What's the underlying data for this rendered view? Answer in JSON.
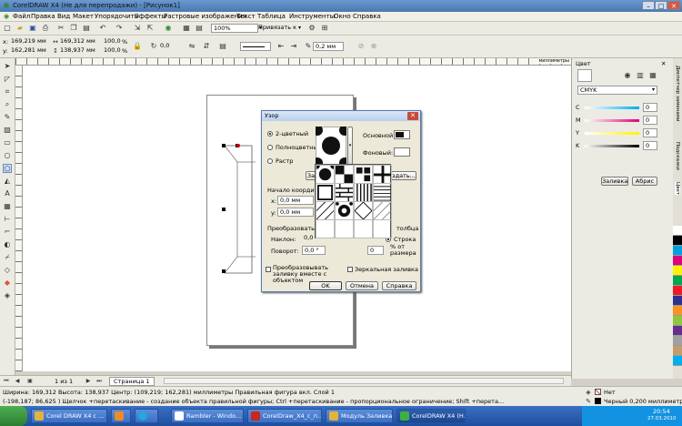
{
  "window": {
    "title": "CorelDRAW X4 (Не для перепродажи) - [Рисунок1]"
  },
  "menu": [
    "Файл",
    "Правка",
    "Вид",
    "Макет",
    "Упорядочить",
    "Эффекты",
    "Растровые изображения",
    "Текст",
    "Таблица",
    "Инструменты",
    "Окно",
    "Справка"
  ],
  "toolbar": {
    "zoom": "100%",
    "snap": "Привязать к"
  },
  "propbar": {
    "x": "169,219 мм",
    "y": "162,281 мм",
    "w": "169,312 мм",
    "h": "138,937 мм",
    "sx": "100,0",
    "sy": "100,0",
    "pct": "%",
    "angle": "0,0",
    "outline": "0,2 мм"
  },
  "ruler": {
    "unit": "миллиметры"
  },
  "docker": {
    "title": "Цвет",
    "model": "CMYK",
    "channels": [
      {
        "label": "C",
        "value": "0"
      },
      {
        "label": "M",
        "value": "0"
      },
      {
        "label": "Y",
        "value": "0"
      },
      {
        "label": "K",
        "value": "0"
      }
    ],
    "fill_btn": "Заливка",
    "outline_btn": "Абрис",
    "tabs": [
      "Диспетчер заменами",
      "Подсказки",
      "Цвет"
    ]
  },
  "dialog": {
    "title": "Узор",
    "close": "✕",
    "radio_2color": "2-цветный",
    "radio_full": "Полноцветный",
    "radio_bitmap": "Растр",
    "front_label": "Основной:",
    "back_label": "Фоновый:",
    "load_partial": "За",
    "edit_partial": "здать...",
    "origin": "Начало координат",
    "x_label": "x:",
    "x_val": "0,0 мм",
    "y_label": "y:",
    "y_val": "0,0 мм",
    "transform": "Преобразовать",
    "skew_label": "Наклон:",
    "skew_val": "0,0",
    "rotate_label": "Поворот:",
    "rotate_val": "0,0 °",
    "row_col_partial": "толбца",
    "row_label": "Строка",
    "col_label": "Столбец",
    "offset_val": "0",
    "offset_unit": "% от размера",
    "transform_chk": "Преобразовывать заливку вместе с объектом",
    "mirror_chk": "Зеркальная заливка",
    "ok": "OK",
    "cancel": "Отмена",
    "help": "Справка"
  },
  "pagebar": {
    "nav": "1 из 1",
    "page_tab": "Страница 1"
  },
  "status": {
    "line1": "Ширина: 169,312  Высота: 138,937  Центр: (109,219; 162,281)  миллиметры        Правильная фигура вкл. Слой 1",
    "line2": "(-198,187; 86,625 )    Щелчок +перетаскивание - создание объекта правильной фигуры; Ctrl +перетаскивание - пропорциональное ограничение; Shift +перета...",
    "fill_none": "Нет",
    "outline_info": "Черный  0,200 миллиметры"
  },
  "taskbar": {
    "items": [
      "Corel DRAW X4 с ...",
      "Rambler - Windo...",
      "CorelDraw_X4_с_п...",
      "Модуль Заливка ...",
      "CorelDRAW X4 (Н..."
    ],
    "time": "20:54",
    "date": "27.03.2010"
  },
  "colors": {
    "palette": [
      "#ffffff",
      "#000000",
      "#00a0e0",
      "#e0007a",
      "#fff200",
      "#00a651",
      "#ed1c24",
      "#2e3192",
      "#f7941d",
      "#8dc63f",
      "#662d91",
      "#a0a0a0",
      "#c69c6d",
      "#00aeef"
    ]
  }
}
